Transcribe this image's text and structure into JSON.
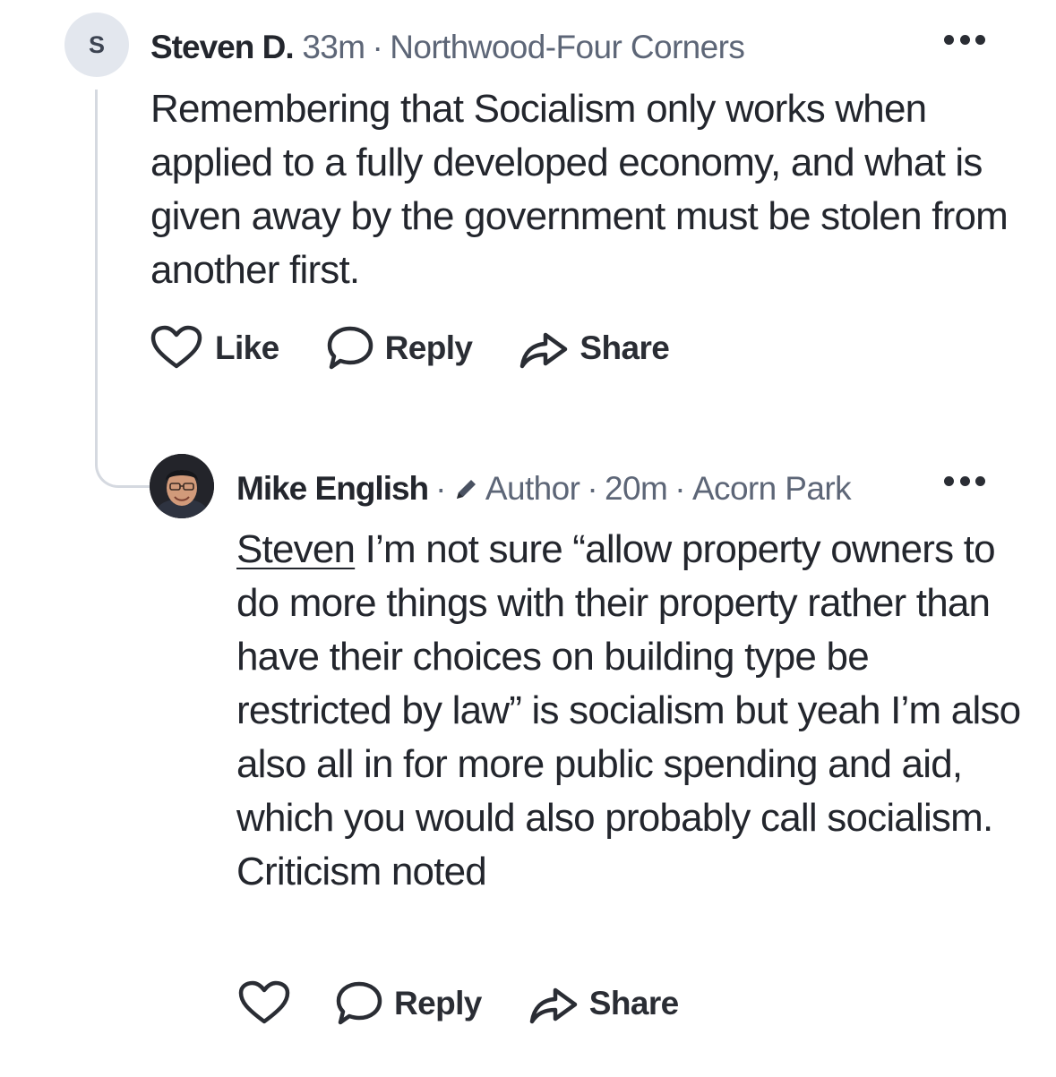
{
  "comment": {
    "avatar_initial": "S",
    "author": "Steven D.",
    "time": "33m",
    "separator": "·",
    "location": "Northwood-Four Corners",
    "text": "Remembering that Socialism only works when applied to a fully developed economy, and what is given away by the government must be stolen from another first.",
    "actions": {
      "like": "Like",
      "reply": "Reply",
      "share": "Share"
    }
  },
  "reply": {
    "author": "Mike English",
    "separator": "·",
    "badge": "Author",
    "time": "20m",
    "location": "Acorn Park",
    "mention": "Steven",
    "text": " I’m not sure “allow property owners to do more things with their property rather than have their choices on building type be restricted by law” is socialism but yeah I’m also also all in for more public spending and aid, which you would also probably call socialism. Criticism noted",
    "actions": {
      "reply": "Reply",
      "share": "Share"
    }
  },
  "icons": [
    "more-icon",
    "heart-icon",
    "speech-bubble-icon",
    "share-arrow-icon",
    "pencil-icon"
  ],
  "colors": {
    "text": "#23262d",
    "muted": "#5d6677",
    "thread_line": "#d5d9e0",
    "avatar_bg": "#e3e7ee"
  }
}
